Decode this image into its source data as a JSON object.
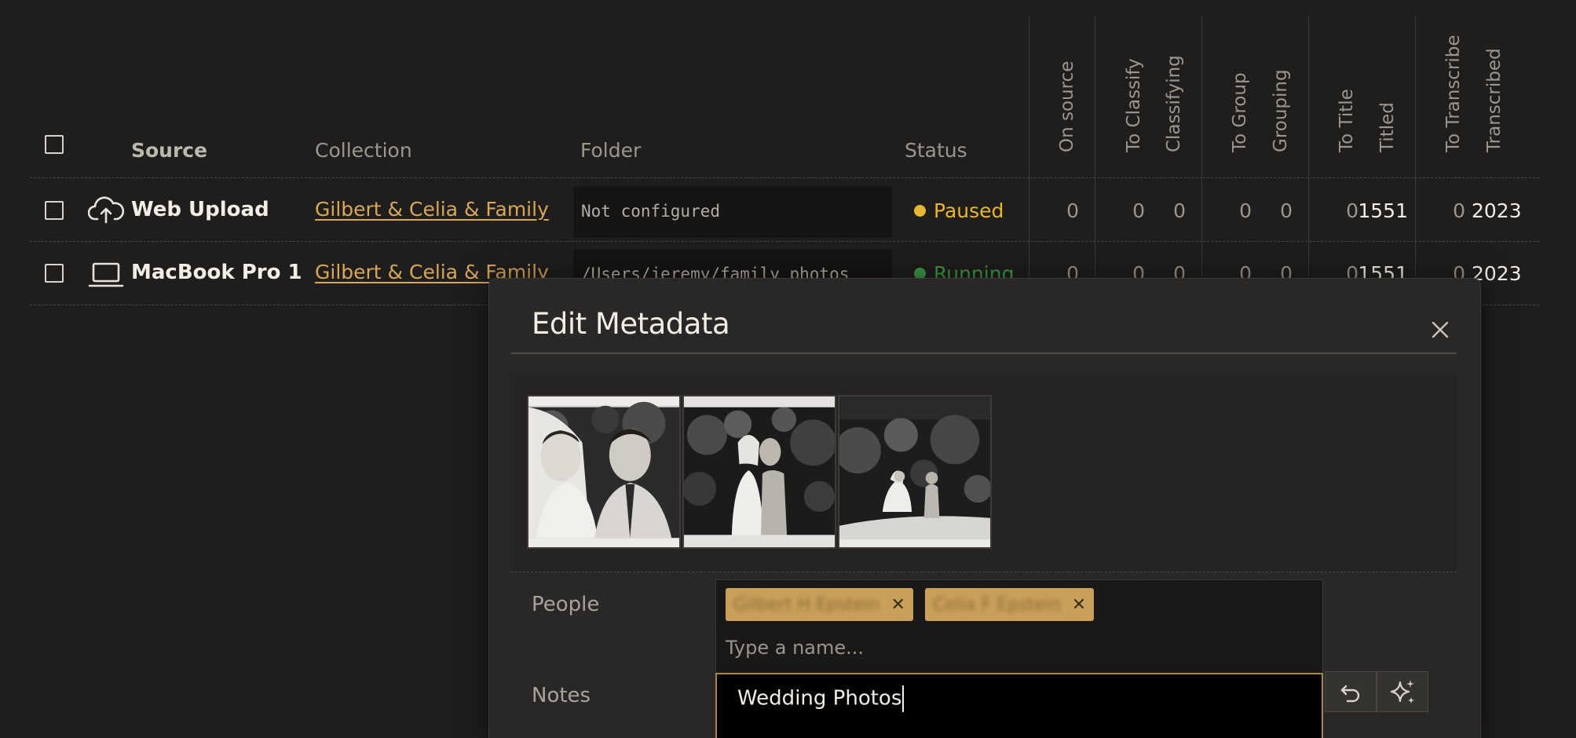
{
  "table": {
    "headers": {
      "source": "Source",
      "collection": "Collection",
      "folder": "Folder",
      "status": "Status",
      "count_columns": [
        "On source",
        "To Classify",
        "Classifying",
        "To Group",
        "Grouping",
        "To Title",
        "Titled",
        "To Transcribe",
        "Transcribed"
      ]
    },
    "rows": [
      {
        "icon": "cloud-upload-icon",
        "source": "Web Upload",
        "collection": "Gilbert & Celia & Family",
        "folder": "Not configured",
        "status": "Paused",
        "status_color": "#e8b732",
        "counts": [
          "0",
          "0",
          "0",
          "0",
          "0",
          "0",
          "1551",
          "0",
          "2023"
        ]
      },
      {
        "icon": "laptop-icon",
        "source": "MacBook Pro 1",
        "collection": "Gilbert & Celia & Family",
        "folder": "/Users/jeremy/family_photos",
        "status": "Running",
        "status_color": "#3f9b4a",
        "counts": [
          "0",
          "0",
          "0",
          "0",
          "0",
          "0",
          "1551",
          "0",
          "2023"
        ]
      }
    ]
  },
  "modal": {
    "title": "Edit Metadata",
    "photos": [
      "wedding-portrait-couple",
      "wedding-kiss",
      "wedding-couple-garden"
    ],
    "people_label": "People",
    "people_tags": [
      "Gilbert H Epstein",
      "Celia F Epstein"
    ],
    "people_placeholder": "Type a name...",
    "notes_label": "Notes",
    "notes_value": "Wedding Photos"
  },
  "colors": {
    "accent": "#d6a85c",
    "background": "#1f1e1c",
    "modal_bg": "#2a2826",
    "tag_bg": "#c9a05a"
  }
}
